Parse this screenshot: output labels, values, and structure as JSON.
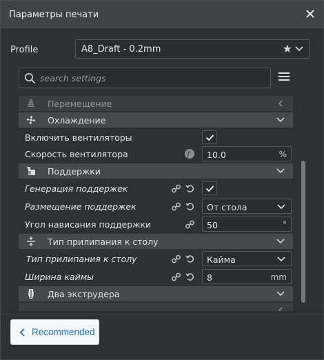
{
  "window": {
    "title": "Параметры печати"
  },
  "profile": {
    "label": "Profile",
    "value": "A8_Draft - 0.2mm"
  },
  "search": {
    "placeholder": "search settings"
  },
  "categories": {
    "movement": {
      "label": "Перемещение"
    },
    "cooling": {
      "label": "Охлаждение"
    },
    "support": {
      "label": "Поддержки"
    },
    "adhesion": {
      "label": "Тип прилипания к столу"
    },
    "dual": {
      "label": "Два экструдера"
    }
  },
  "settings": {
    "enable_fans": {
      "label": "Включить вентиляторы",
      "checked": true
    },
    "fan_speed": {
      "label": "Скорость вентилятора",
      "value": "10.0",
      "unit": "%"
    },
    "generate_support": {
      "label": "Генерация поддержек",
      "checked": true
    },
    "support_placement": {
      "label": "Размещение поддержек",
      "value": "От стола"
    },
    "support_angle": {
      "label": "Угол нависания поддержки",
      "value": "50",
      "unit": "°"
    },
    "adhesion_type": {
      "label": "Тип прилипания к столу",
      "value": "Кайма"
    },
    "brim_width": {
      "label": "Ширина каймы",
      "value": "8",
      "unit": "mm"
    }
  },
  "footer": {
    "recommended_label": "Recommended"
  },
  "colors": {
    "accent": "#1f6fd1",
    "panel": "#2e3034",
    "category": "#45484d"
  }
}
